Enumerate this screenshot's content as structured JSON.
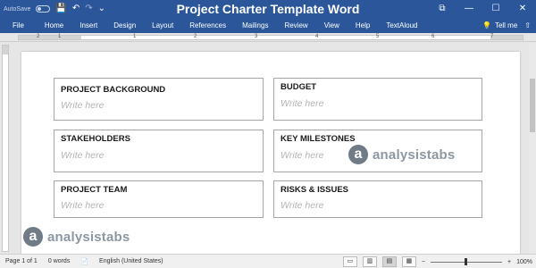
{
  "titlebar": {
    "title": "Project Charter Template Word",
    "autosave_label": "AutoSave",
    "autosave_state": "Off",
    "undo_icon": "undo-icon",
    "redo_icon": "redo-icon",
    "save_icon": "save-icon",
    "min_glyph": "—",
    "max_glyph": "☐",
    "close_glyph": "✕",
    "ribbon_display_glyph": "⧉"
  },
  "ribbon": {
    "tabs": [
      "File",
      "Home",
      "Insert",
      "Design",
      "Layout",
      "References",
      "Mailings",
      "Review",
      "View",
      "Help",
      "TextAloud"
    ],
    "tell_me": "Tell me",
    "share_glyph": "⇧"
  },
  "ruler": {
    "numbers": [
      "2",
      "1",
      "1",
      "2",
      "3",
      "4",
      "5",
      "6",
      "7"
    ]
  },
  "document": {
    "placeholder": "Write here",
    "boxes": [
      {
        "title": "PROJECT BACKGROUND",
        "body": "Write here"
      },
      {
        "title": "BUDGET",
        "body": "Write here"
      },
      {
        "title": "STAKEHOLDERS",
        "body": "Write here"
      },
      {
        "title": "KEY MILESTONES",
        "body": "Write here"
      },
      {
        "title": "PROJECT TEAM",
        "body": "Write here"
      },
      {
        "title": "RISKS & ISSUES",
        "body": "Write here"
      }
    ],
    "watermark": {
      "logo_letter": "a",
      "brand": "analysistabs"
    }
  },
  "statusbar": {
    "page": "Page 1 of 1",
    "words": "0 words",
    "language": "English (United States)",
    "zoom_out": "−",
    "zoom_in": "+",
    "zoom": "100%"
  },
  "colors": {
    "accent": "#2b579a"
  }
}
